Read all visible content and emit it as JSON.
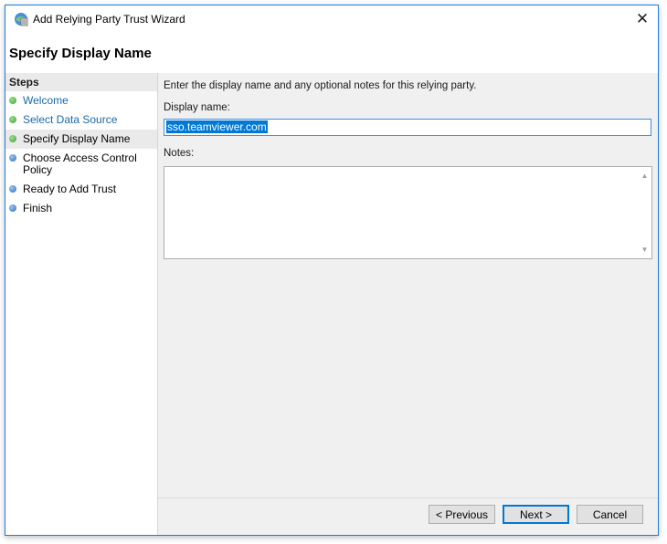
{
  "window": {
    "title": "Add Relying Party Trust Wizard",
    "page_title": "Specify Display Name",
    "close_icon": "close-icon"
  },
  "steps": {
    "header": "Steps",
    "items": [
      {
        "label": "Welcome",
        "state": "completed"
      },
      {
        "label": "Select Data Source",
        "state": "completed"
      },
      {
        "label": "Specify Display Name",
        "state": "current"
      },
      {
        "label": "Choose Access Control Policy",
        "state": "pending"
      },
      {
        "label": "Ready to Add Trust",
        "state": "pending"
      },
      {
        "label": "Finish",
        "state": "pending"
      }
    ]
  },
  "form": {
    "instructions": "Enter the display name and any optional notes for this relying party.",
    "display_name_label": "Display name:",
    "display_name_value": "sso.teamviewer.com",
    "notes_label": "Notes:",
    "notes_value": ""
  },
  "buttons": {
    "previous": "< Previous",
    "next": "Next >",
    "cancel": "Cancel"
  },
  "colors": {
    "accent": "#0078d7",
    "completed": "#3aa33a",
    "pending": "#2a6fc0",
    "link": "#1a6aa8"
  }
}
